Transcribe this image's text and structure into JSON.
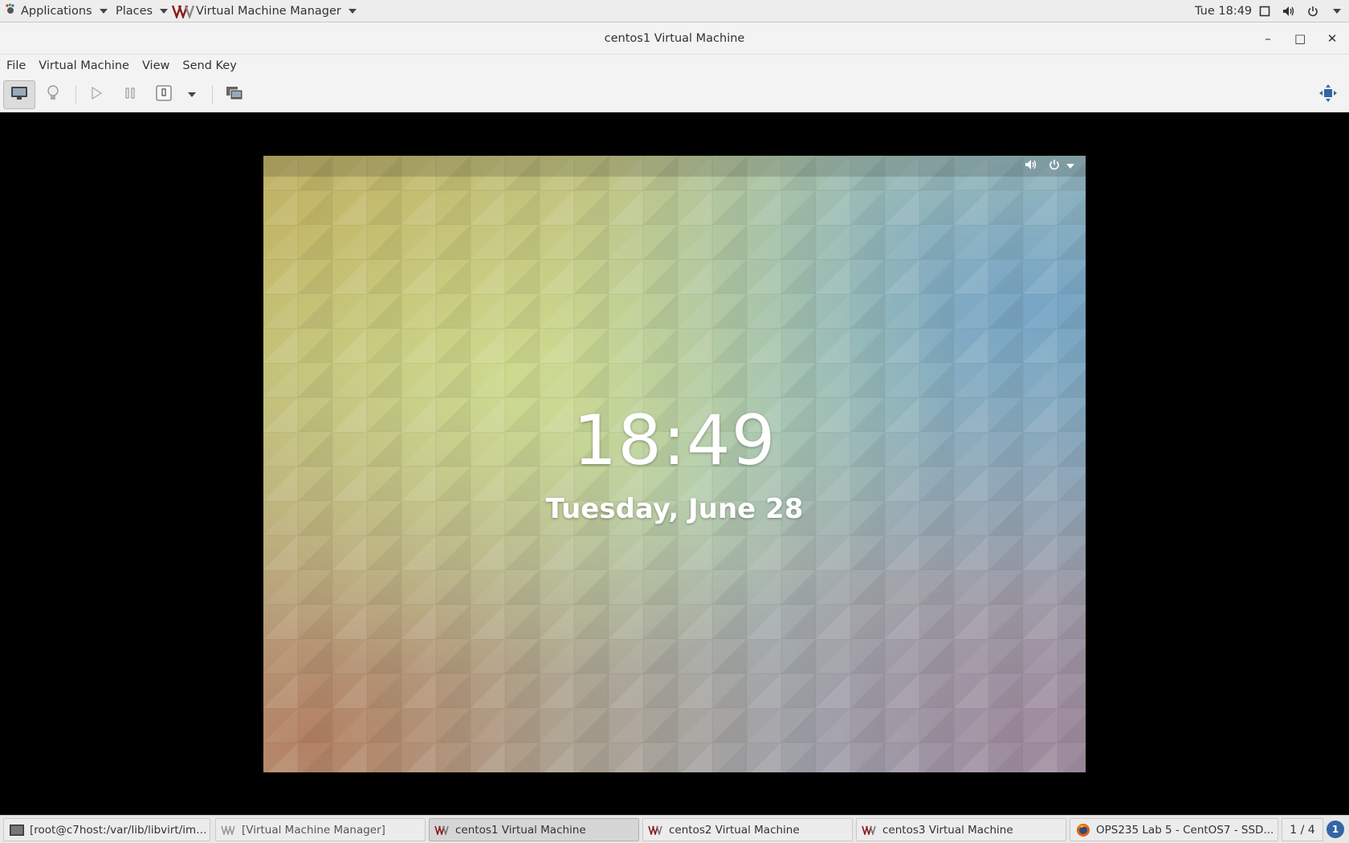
{
  "topbar": {
    "applications": "Applications",
    "places": "Places",
    "app_menu": "Virtual Machine Manager",
    "clock": "Tue 18:49"
  },
  "window": {
    "title": "centos1 Virtual Machine",
    "minimize": "–",
    "maximize": "□",
    "close": "✕"
  },
  "menubar": {
    "items": [
      "File",
      "Virtual Machine",
      "View",
      "Send Key"
    ]
  },
  "guest": {
    "time": "18:49",
    "date": "Tuesday, June 28"
  },
  "taskbar": {
    "tasks": [
      {
        "label": "[root@c7host:/var/lib/libvirt/imag...",
        "icon": "terminal-icon"
      },
      {
        "label": "[Virtual Machine Manager]",
        "icon": "vmm-icon"
      },
      {
        "label": "centos1 Virtual Machine",
        "icon": "vmm-icon"
      },
      {
        "label": "centos2 Virtual Machine",
        "icon": "vmm-icon"
      },
      {
        "label": "centos3 Virtual Machine",
        "icon": "vmm-icon"
      },
      {
        "label": "OPS235 Lab 5 - CentOS7 - SSD...",
        "icon": "firefox-icon"
      }
    ],
    "workspace": "1 / 4",
    "notifications": "1"
  }
}
